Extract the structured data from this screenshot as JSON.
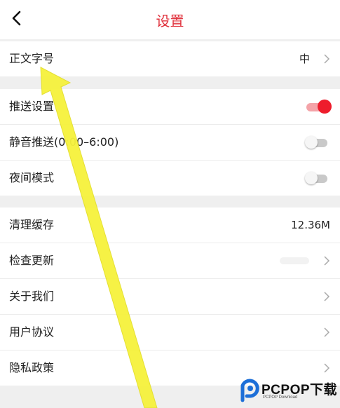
{
  "header": {
    "title": "设置",
    "back_icon": "chevron-left-icon"
  },
  "groups": {
    "font": {
      "label": "正文字号",
      "value": "中"
    },
    "push": [
      {
        "label": "推送设置",
        "toggle": true
      },
      {
        "label": "静音推送(0:00–6:00)",
        "toggle": false
      },
      {
        "label": "夜间模式",
        "toggle": false
      }
    ],
    "misc": {
      "cache_label": "清理缓存",
      "cache_value": "12.36M",
      "update_label": "检查更新",
      "about_label": "关于我们",
      "agreement_label": "用户协议",
      "privacy_label": "隐私政策"
    }
  },
  "colors": {
    "accent": "#e0313c",
    "toggle_on": "#ee1c2c",
    "background": "#efefef",
    "arrow": "#f6f23c"
  },
  "watermark": {
    "brand": "PCPOP下载",
    "sub": "PCPOP Download"
  }
}
